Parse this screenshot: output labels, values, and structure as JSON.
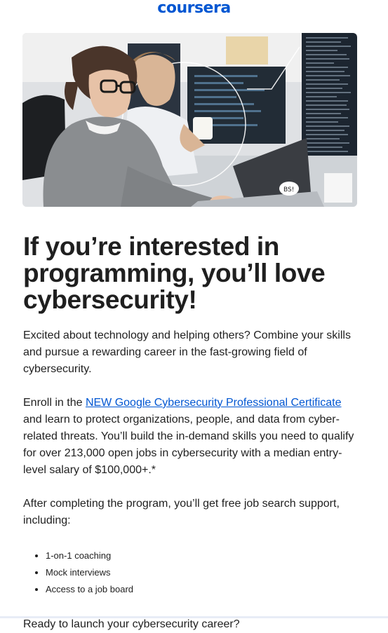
{
  "header": {
    "logo_text": "coursera"
  },
  "hero": {
    "image_description": "hero-illustration"
  },
  "main": {
    "headline": "If you’re interested in programming, you’ll love cybersecurity!",
    "intro": "Excited about technology and helping others? Combine your skills and pursue a rewarding career in the fast-growing field of cybersecurity.",
    "enroll_prefix": "Enroll in the ",
    "enroll_link": "NEW Google Cybersecurity Professional Certificate",
    "enroll_suffix": " and learn to protect organizations, people, and data from cyber-related threats. You’ll build the in-demand skills you need to qualify for over 213,000 open jobs in cybersecurity with a median entry-level salary of $100,000+.*",
    "support_intro": "After completing the program, you’ll get free job search support, including:",
    "support_items": [
      "1-on-1 coaching",
      "Mock interviews",
      "Access to a job board"
    ],
    "cta_question": "Ready to launch your cybersecurity career?"
  },
  "colors": {
    "brand": "#0056d2",
    "text": "#1f1f1f"
  }
}
